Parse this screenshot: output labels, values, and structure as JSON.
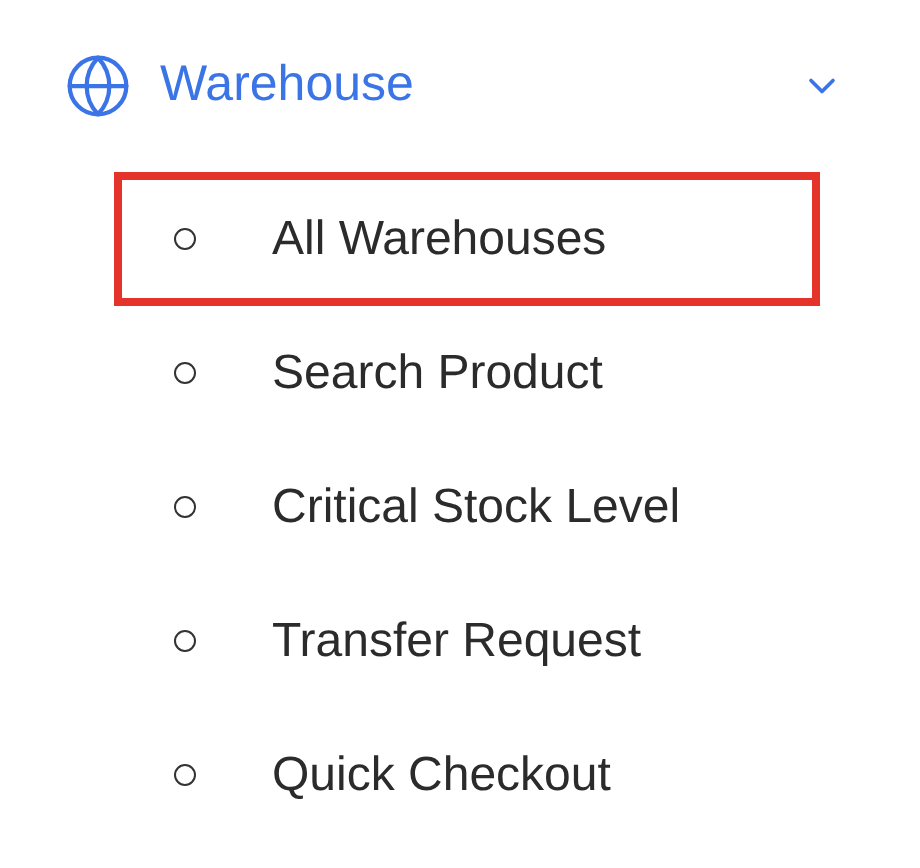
{
  "menu": {
    "label": "Warehouse",
    "expanded": true,
    "items": [
      {
        "label": "All Warehouses",
        "highlighted": true
      },
      {
        "label": "Search Product",
        "highlighted": false
      },
      {
        "label": "Critical Stock Level",
        "highlighted": false
      },
      {
        "label": "Transfer Request",
        "highlighted": false
      },
      {
        "label": "Quick Checkout",
        "highlighted": false
      }
    ]
  }
}
